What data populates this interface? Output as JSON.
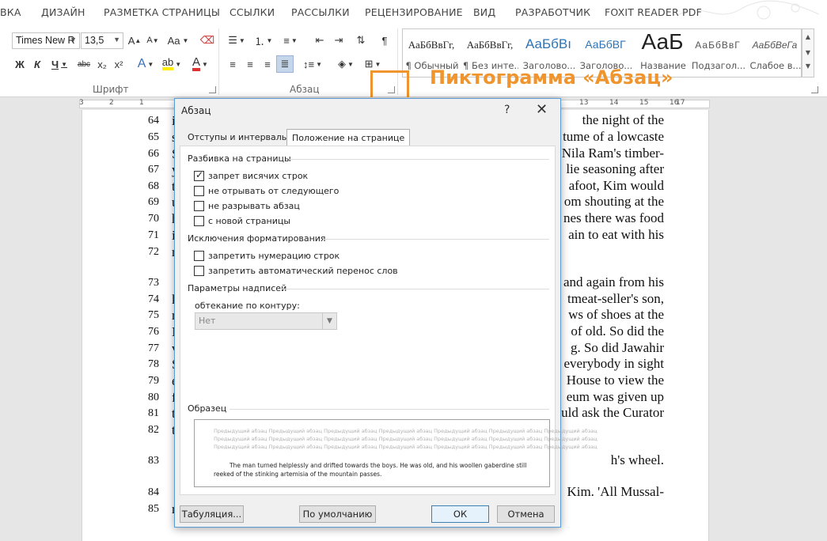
{
  "ribbon": {
    "tabs": [
      "ВКА",
      "ДИЗАЙН",
      "РАЗМЕТКА СТРАНИЦЫ",
      "ССЫЛКИ",
      "РАССЫЛКИ",
      "РЕЦЕНЗИРОВАНИЕ",
      "ВИД",
      "РАЗРАБОТЧИК",
      "FOXIT READER PDF"
    ],
    "font_group": {
      "label": "Шрифт",
      "font_name": "Times New R",
      "font_size": "13,5",
      "grow": "A",
      "shrink": "A",
      "case": "Aa",
      "bold": "Ж",
      "italic": "К",
      "underline": "Ч",
      "strike": "abc",
      "sub": "x₂",
      "sup": "x²"
    },
    "para_group": {
      "label": "Абзац"
    },
    "styles_group": {
      "items": [
        {
          "preview": "АаБбВвГг,",
          "name": "¶ Обычный"
        },
        {
          "preview": "АаБбВвГг,",
          "name": "¶ Без инте..."
        },
        {
          "preview": "АаБбВı",
          "name": "Заголово..."
        },
        {
          "preview": "АаБбВГ",
          "name": "Заголово..."
        },
        {
          "preview": "АаБ",
          "name": "Название"
        },
        {
          "preview": "АаБбВвГ",
          "name": "Подзагол..."
        },
        {
          "preview": "АаБбВеГа",
          "name": "Слабое в..."
        }
      ]
    }
  },
  "annotation": {
    "label": "Пиктограмма «Абзац»",
    "color": "#f0952d"
  },
  "ruler": {
    "marks": [
      "3",
      "2",
      "1",
      "1",
      "2",
      "13",
      "14",
      "15",
      "16",
      "17"
    ]
  },
  "document": {
    "lines": [
      {
        "num": "64",
        "text": "the night of the",
        "cut": "i"
      },
      {
        "num": "65",
        "text": "tume of a lowcaste",
        "cut": "s"
      },
      {
        "num": "66",
        "text": "Nila Ram's timber-",
        "cut": "S"
      },
      {
        "num": "67",
        "text": "lie seasoning after",
        "cut": "y"
      },
      {
        "num": "68",
        "text": "afoot, Kim would",
        "cut": "t"
      },
      {
        "num": "69",
        "text": "om shouting at the",
        "cut": "u"
      },
      {
        "num": "70",
        "text": "nes there was food",
        "cut": "h"
      },
      {
        "num": "71",
        "text": "ain to eat with his",
        "cut": "i"
      },
      {
        "num": "72",
        "text": "",
        "cut": "r"
      },
      {
        "num": "73",
        "text": "and again from his",
        "cut": ""
      },
      {
        "num": "74",
        "text": "tmeat-seller's son,",
        "cut": "k"
      },
      {
        "num": "75",
        "text": "ws of shoes at the",
        "cut": "r"
      },
      {
        "num": "76",
        "text": "of old. So did the",
        "cut": "N"
      },
      {
        "num": "77",
        "text": "g. So did Jawahir",
        "cut": "v"
      },
      {
        "num": "78",
        "text": "everybody in sight",
        "cut": "S"
      },
      {
        "num": "79",
        "text": "House to view the",
        "cut": "e"
      },
      {
        "num": "80",
        "text": "eum was given up",
        "cut": "f"
      },
      {
        "num": "81",
        "text": "uld ask the Curator",
        "cut": "t"
      },
      {
        "num": "82",
        "text": "",
        "cut": "t"
      },
      {
        "num": "83",
        "text": "h's wheel.",
        "cut": ""
      },
      {
        "num": "84",
        "text": "Kim. 'All Mussal-",
        "cut": ""
      },
      {
        "num": "85",
        "text": "",
        "cut": "r"
      }
    ]
  },
  "dialog": {
    "title": "Абзац",
    "help": "?",
    "close": "✕",
    "tabs": [
      {
        "label": "Отступы и интервалы",
        "active": false
      },
      {
        "label": "Положение на странице",
        "active": true
      }
    ],
    "pagination": {
      "title": "Разбивка на страницы",
      "options": [
        {
          "label": "запрет висячих строк",
          "checked": true
        },
        {
          "label": "не отрывать от следующего",
          "checked": false
        },
        {
          "label": "не разрывать абзац",
          "checked": false
        },
        {
          "label": "с новой страницы",
          "checked": false
        }
      ]
    },
    "formatting": {
      "title": "Исключения форматирования",
      "options": [
        {
          "label": "запретить нумерацию строк",
          "checked": false
        },
        {
          "label": "запретить автоматический перенос слов",
          "checked": false
        }
      ]
    },
    "textbox": {
      "title": "Параметры надписей",
      "wrap_label": "обтекание по контуру:",
      "wrap_value": "Нет"
    },
    "sample": {
      "title": "Образец",
      "prev_lines": [
        "Предыдущий абзац Предыдущий абзац Предыдущий абзац Предыдущий абзац Предыдущий абзац Предыдущий абзац Предыдущий абзац",
        "Предыдущий абзац Предыдущий абзац Предыдущий абзац Предыдущий абзац Предыдущий абзац Предыдущий абзац Предыдущий абзац",
        "Предыдущий абзац Предыдущий абзац Предыдущий абзац Предыдущий абзац Предыдущий абзац Предыдущий абзац Предыдущий абзац"
      ],
      "main_text": "The man turned helplessly and drifted towards the boys. He was old, and his woollen gaberdine still reeked of the stinking artemisia of the mountain passes."
    },
    "buttons": {
      "tabs": "Табуляция...",
      "default": "По умолчанию",
      "ok": "ОК",
      "cancel": "Отмена"
    }
  }
}
